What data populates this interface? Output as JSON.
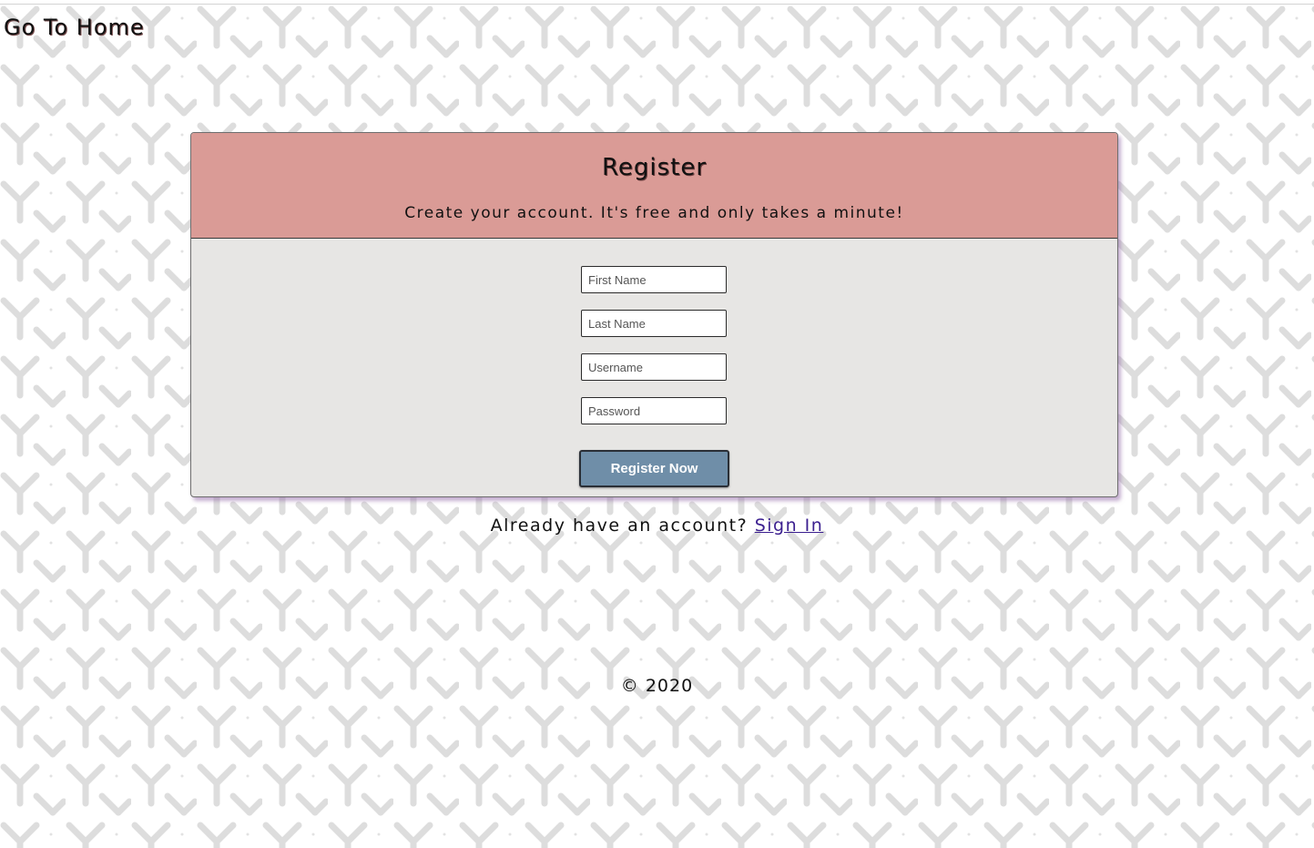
{
  "nav": {
    "home_link": "Go To Home"
  },
  "register": {
    "title": "Register",
    "subtitle": "Create your account. It's free and only takes a minute!",
    "fields": [
      {
        "placeholder": "First Name",
        "value": ""
      },
      {
        "placeholder": "Last Name",
        "value": ""
      },
      {
        "placeholder": "Username",
        "value": ""
      },
      {
        "placeholder": "Password",
        "value": ""
      }
    ],
    "submit_label": "Register Now"
  },
  "signin": {
    "prompt": "Already have an account?",
    "link_label": "Sign In"
  },
  "footer": {
    "copyright": "© 2020"
  },
  "colors": {
    "header_bg": "#da9b96",
    "body_bg": "#e7e6e4",
    "button_bg": "#6f8ea8",
    "link": "#3b1f8f",
    "pattern": "#dcdcdc"
  },
  "icons": {
    "background": "y-shape-pattern"
  }
}
